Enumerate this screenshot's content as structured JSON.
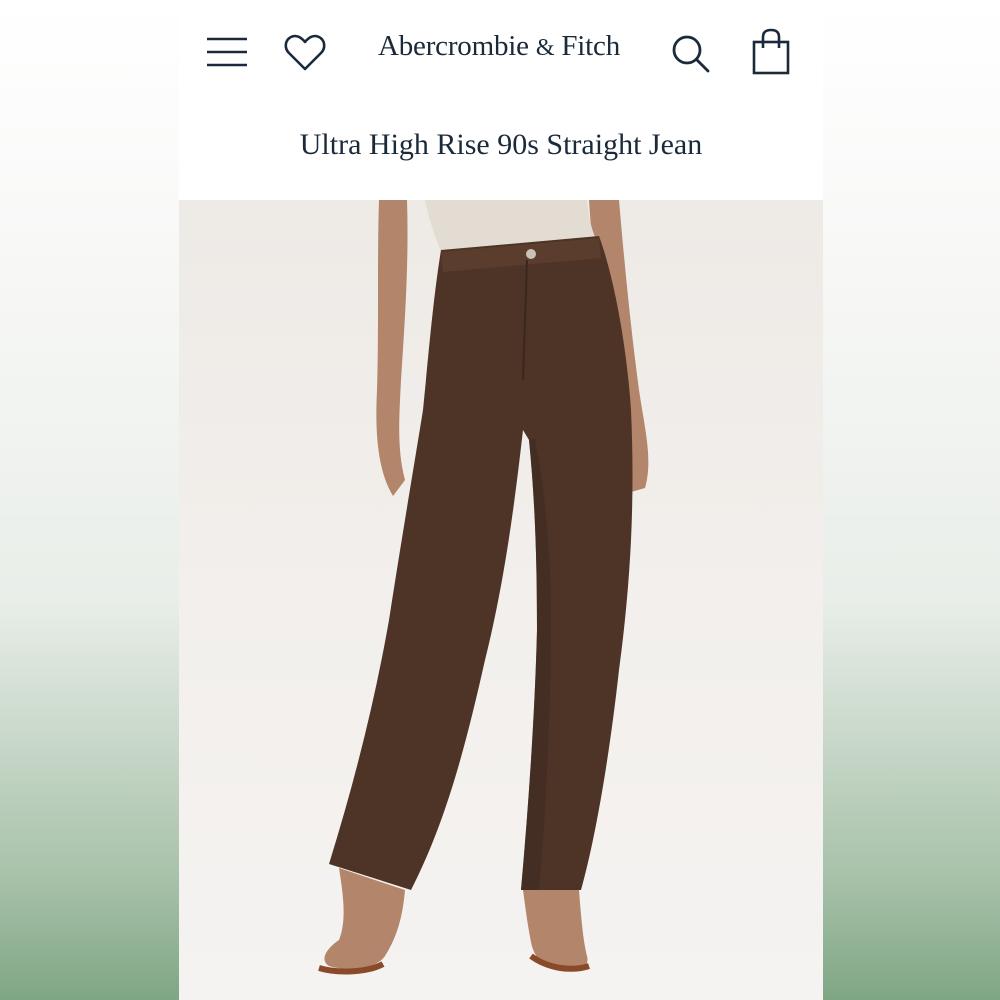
{
  "header": {
    "brand_main": "Abercrombie",
    "brand_amp": "&",
    "brand_end": "Fitch",
    "icons": [
      "menu-icon",
      "heart-icon",
      "search-icon",
      "shopping-bag-icon"
    ]
  },
  "product": {
    "title": "Ultra High Rise 90s Straight Jean",
    "image": "product-photo"
  },
  "colors": {
    "text": "#1b2a3a",
    "denim": "#4e3426",
    "background_green": "#7fa684"
  }
}
